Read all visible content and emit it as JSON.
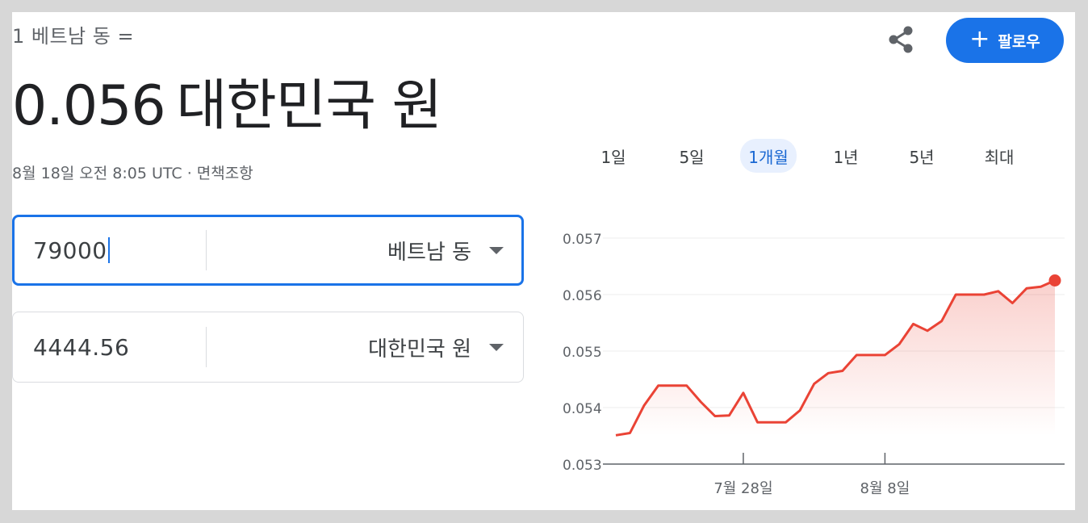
{
  "header": {
    "subtitle": "1 베트남 동 =",
    "rate_value": "0.056",
    "rate_currency": "대한민국 원",
    "timestamp": "8월 18일 오전 8:05 UTC · 면책조항"
  },
  "actions": {
    "share_icon": "share-icon",
    "follow_icon": "plus-icon",
    "follow_label": "팔로우",
    "accent_color": "#1a73e8"
  },
  "range_tabs": [
    {
      "label": "1일",
      "active": false
    },
    {
      "label": "5일",
      "active": false
    },
    {
      "label": "1개월",
      "active": true
    },
    {
      "label": "1년",
      "active": false
    },
    {
      "label": "5년",
      "active": false
    },
    {
      "label": "최대",
      "active": false
    }
  ],
  "converter": {
    "from": {
      "amount": "79000",
      "currency": "베트남 동"
    },
    "to": {
      "amount": "4444.56",
      "currency": "대한민국 원"
    }
  },
  "chart_data": {
    "type": "line",
    "title": "",
    "xlabel": "",
    "ylabel": "",
    "ylim": [
      0.053,
      0.057
    ],
    "yticks": [
      "0.057",
      "0.056",
      "0.055",
      "0.054",
      "0.053"
    ],
    "xticks": [
      {
        "label": "7월 28일",
        "index": 9
      },
      {
        "label": "8월 8일",
        "index": 19
      }
    ],
    "line_color": "#ea4335",
    "grid": true,
    "series": [
      {
        "values": [
          0.05351,
          0.05355,
          0.05404,
          0.05439,
          0.05439,
          0.05439,
          0.0541,
          0.05385,
          0.05386,
          0.05426,
          0.05374,
          0.05374,
          0.05374,
          0.05395,
          0.05442,
          0.05461,
          0.05465,
          0.05493,
          0.05493,
          0.05493,
          0.05512,
          0.05548,
          0.05536,
          0.05553,
          0.056,
          0.056,
          0.056,
          0.05606,
          0.05585,
          0.05611,
          0.05614,
          0.05625
        ]
      }
    ]
  }
}
